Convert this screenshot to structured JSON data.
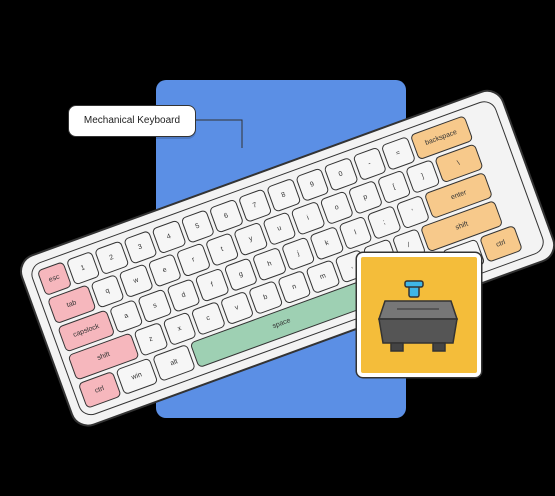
{
  "callout": {
    "label": "Mechanical Keyboard"
  },
  "colors": {
    "blue_card": "#5b8fe5",
    "case": "#f3f3f3",
    "key_white": "#f6f6f6",
    "key_pink": "#f6b7bd",
    "key_orange": "#f7c98b",
    "key_green": "#9ed0b3",
    "switch_bg": "#f4bd3a",
    "switch_body": "#555",
    "switch_stem": "#3fb6e6"
  },
  "keys": {
    "rows": [
      {
        "pad": 0,
        "keys": [
          {
            "t": "esc",
            "w": 1,
            "c": "pink"
          },
          {
            "t": "1",
            "w": 1
          },
          {
            "t": "2",
            "w": 1
          },
          {
            "t": "3",
            "w": 1
          },
          {
            "t": "4",
            "w": 1
          },
          {
            "t": "5",
            "w": 1
          },
          {
            "t": "6",
            "w": 1
          },
          {
            "t": "7",
            "w": 1
          },
          {
            "t": "8",
            "w": 1
          },
          {
            "t": "9",
            "w": 1
          },
          {
            "t": "0",
            "w": 1
          },
          {
            "t": "-",
            "w": 1
          },
          {
            "t": "=",
            "w": 1
          },
          {
            "t": "backspace",
            "w": 2,
            "c": "orange"
          }
        ]
      },
      {
        "pad": 0,
        "keys": [
          {
            "t": "tab",
            "w": 1.5,
            "c": "pink"
          },
          {
            "t": "q",
            "w": 1
          },
          {
            "t": "w",
            "w": 1
          },
          {
            "t": "e",
            "w": 1
          },
          {
            "t": "r",
            "w": 1
          },
          {
            "t": "t",
            "w": 1
          },
          {
            "t": "y",
            "w": 1
          },
          {
            "t": "u",
            "w": 1
          },
          {
            "t": "i",
            "w": 1
          },
          {
            "t": "o",
            "w": 1
          },
          {
            "t": "p",
            "w": 1
          },
          {
            "t": "[",
            "w": 1
          },
          {
            "t": "]",
            "w": 1
          },
          {
            "t": "\\",
            "w": 1.5,
            "c": "orange"
          }
        ]
      },
      {
        "pad": 0,
        "keys": [
          {
            "t": "capslock",
            "w": 1.8,
            "c": "pink"
          },
          {
            "t": "a",
            "w": 1
          },
          {
            "t": "s",
            "w": 1
          },
          {
            "t": "d",
            "w": 1
          },
          {
            "t": "f",
            "w": 1
          },
          {
            "t": "g",
            "w": 1
          },
          {
            "t": "h",
            "w": 1
          },
          {
            "t": "j",
            "w": 1
          },
          {
            "t": "k",
            "w": 1
          },
          {
            "t": "l",
            "w": 1
          },
          {
            "t": ";",
            "w": 1
          },
          {
            "t": "'",
            "w": 1
          },
          {
            "t": "enter",
            "w": 2.2,
            "c": "orange"
          }
        ]
      },
      {
        "pad": 0,
        "keys": [
          {
            "t": "shift",
            "w": 2.3,
            "c": "pink"
          },
          {
            "t": "z",
            "w": 1
          },
          {
            "t": "x",
            "w": 1
          },
          {
            "t": "c",
            "w": 1
          },
          {
            "t": "v",
            "w": 1
          },
          {
            "t": "b",
            "w": 1
          },
          {
            "t": "n",
            "w": 1
          },
          {
            "t": "m",
            "w": 1
          },
          {
            "t": ",",
            "w": 1
          },
          {
            "t": ".",
            "w": 1
          },
          {
            "t": "/",
            "w": 1
          },
          {
            "t": "shift",
            "w": 2.7,
            "c": "orange"
          }
        ]
      },
      {
        "pad": 0,
        "keys": [
          {
            "t": "ctrl",
            "w": 1.3,
            "c": "pink"
          },
          {
            "t": "win",
            "w": 1.3
          },
          {
            "t": "alt",
            "w": 1.3
          },
          {
            "t": "space",
            "w": 6.2,
            "c": "green"
          },
          {
            "t": "alt",
            "w": 1.3
          },
          {
            "t": "fn",
            "w": 1.3
          },
          {
            "t": "fn2",
            "w": 1.3
          },
          {
            "t": "ctrl",
            "w": 1.3,
            "c": "orange"
          }
        ]
      }
    ]
  }
}
